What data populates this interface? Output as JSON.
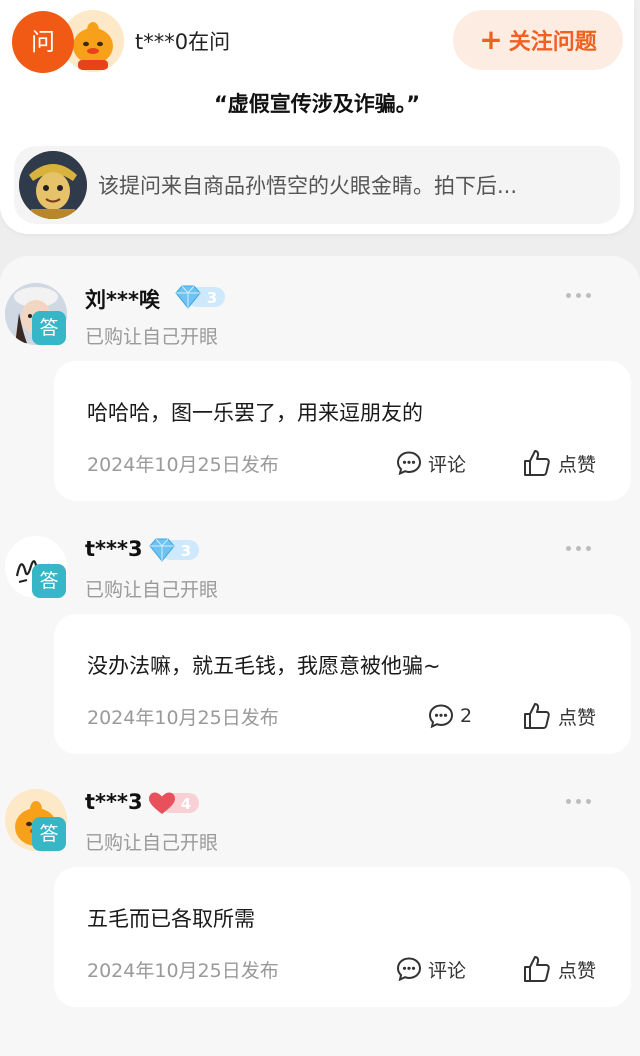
{
  "question": {
    "badge": "问",
    "asker": "t***0在问",
    "follow_label": "关注问题",
    "title": "“虚假宣传涉及诈骗。”",
    "source_text": "该提问来自商品孙悟空的火眼金睛。拍下后..."
  },
  "answers": [
    {
      "user": "刘***唉",
      "level": "3",
      "level_type": "diamond",
      "badge": "答",
      "status": "已购让自己开眼",
      "text": "哈哈哈，图一乐罢了，用来逗朋友的",
      "date": "2024年10月25日发布",
      "comment_label": "评论",
      "like_label": "点赞"
    },
    {
      "user": "t***3",
      "level": "3",
      "level_type": "diamond",
      "badge": "答",
      "status": "已购让自己开眼",
      "text": "没办法嘛，就五毛钱，我愿意被他骗~",
      "date": "2024年10月25日发布",
      "comment_label": "2",
      "like_label": "点赞"
    },
    {
      "user": "t***3",
      "level": "4",
      "level_type": "heart",
      "badge": "答",
      "status": "已购让自己开眼",
      "text": "五毛而已各取所需",
      "date": "2024年10月25日发布",
      "comment_label": "评论",
      "like_label": "点赞"
    }
  ],
  "colors": {
    "accent": "#f05a14",
    "answer_badge": "#36b6c6",
    "diamond": "#6ec3f2",
    "heart": "#e8505b"
  }
}
